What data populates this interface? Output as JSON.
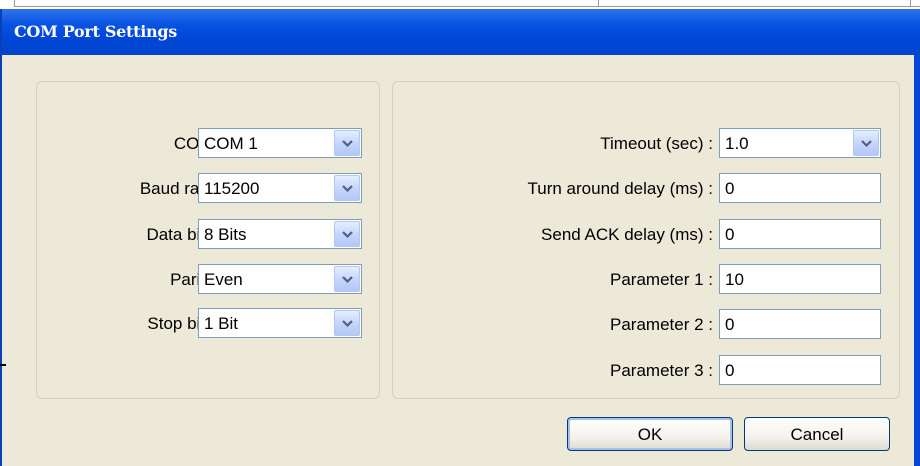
{
  "window": {
    "title": "COM Port Settings"
  },
  "serial": {
    "com": {
      "label": "COM :",
      "value": "COM 1"
    },
    "baud_rate": {
      "label": "Baud rate :",
      "value": "115200"
    },
    "data_bits": {
      "label": "Data bits :",
      "value": "8 Bits"
    },
    "parity": {
      "label": "Parity :",
      "value": "Even"
    },
    "stop_bits": {
      "label": "Stop bits :",
      "value": "1 Bit"
    }
  },
  "timing": {
    "timeout": {
      "label": "Timeout (sec) :",
      "value": "1.0"
    },
    "turn_around_delay": {
      "label": "Turn around delay (ms) :",
      "value": "0"
    },
    "send_ack_delay": {
      "label": "Send ACK delay (ms) :",
      "value": "0"
    },
    "parameter_1": {
      "label": "Parameter 1 :",
      "value": "10"
    },
    "parameter_2": {
      "label": "Parameter 2 :",
      "value": "0"
    },
    "parameter_3": {
      "label": "Parameter 3 :",
      "value": "0"
    }
  },
  "buttons": {
    "ok": "OK",
    "cancel": "Cancel"
  },
  "colors": {
    "titlebar": "#0a55e4",
    "client_bg": "#ece9d8",
    "field_border": "#7f9db9"
  },
  "icons": {
    "dropdown": "chevron-down-icon"
  }
}
